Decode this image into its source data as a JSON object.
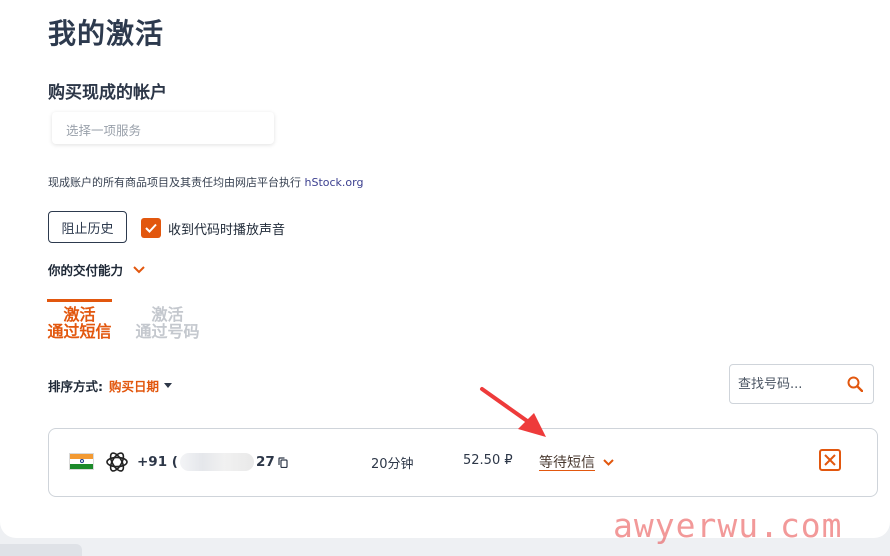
{
  "page": {
    "title": "我的激活"
  },
  "buy": {
    "section_title": "购买现成的帐户",
    "service_placeholder": "选择一项服务",
    "notice_text": "现成账户的所有商品项目及其责任均由网店平台执行 ",
    "notice_link": "hStock.org"
  },
  "controls": {
    "history_button": "阻止历史",
    "sound_checkbox_label": "收到代码时播放声音",
    "sound_checked": true,
    "capability_label": "你的交付能力"
  },
  "tabs": [
    {
      "line1": "激活",
      "line2": "通过短信",
      "active": true
    },
    {
      "line1": "激活",
      "line2": "通过号码",
      "active": false
    }
  ],
  "sort": {
    "label": "排序方式:",
    "value": "购买日期"
  },
  "search": {
    "placeholder": "查找号码..."
  },
  "activation": {
    "country_flag": "india-flag",
    "service_icon": "openai-icon",
    "phone_prefix": "+91 (",
    "phone_suffix": "27",
    "duration": "20分钟",
    "price": "52.50 ₽",
    "status": "等待短信"
  },
  "watermark": "awyerwu.com",
  "colors": {
    "accent": "#e2570e",
    "title": "#2d3a4e",
    "annotation_arrow": "#ee3b3b"
  }
}
